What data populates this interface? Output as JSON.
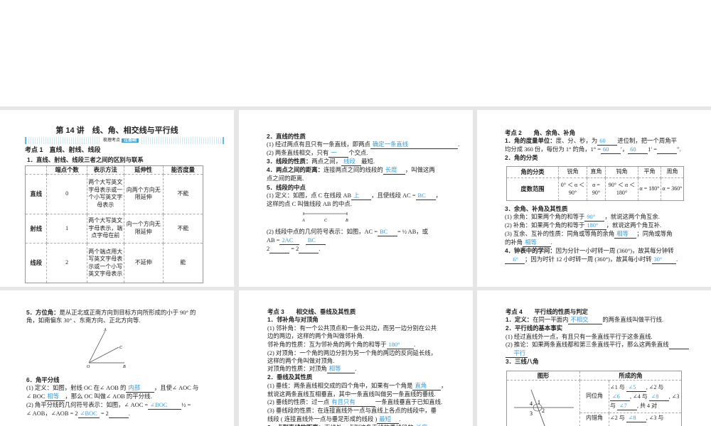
{
  "p1": {
    "title": "第 14 讲　线、角、相交线与平行线",
    "banner_left": "梳理考点",
    "banner_right": "过基础",
    "kd": "考点 1　直线、射线、线段",
    "l1": "1．直线、射线、线段三者之间的区别与联系",
    "table": {
      "headers": [
        "",
        "端点个数",
        "表示方法",
        "延伸性",
        "能否度量"
      ],
      "rows": [
        [
          "直线",
          "0",
          "两个大写英文字母表示或一个小写英文字母表示",
          "向两个方向无限延伸",
          "不能"
        ],
        [
          "射线",
          "1",
          "两个大写英文字母表示，端点字母在前",
          "向一个方向无限延伸",
          "不能"
        ],
        [
          "线段",
          "2",
          "两个端点用大写英文字母表示或一个小写英文字母表示",
          "不延伸",
          "能"
        ]
      ]
    }
  },
  "p2": {
    "a": [
      [
        {
          "s": "2．直线的性质"
        }
      ],
      [
        {
          "t": "(1) 经过两点有且只有一条直线，即两点"
        },
        {
          "b": "确定一条直线　　　　　　　　"
        },
        {
          "t": "."
        }
      ],
      [
        {
          "t": "(2) 两条直线相交，只有"
        },
        {
          "b": "一"
        },
        {
          "t": "个交点."
        }
      ],
      [
        {
          "s": "3．线段的性质："
        },
        {
          "t": "两点之间，"
        },
        {
          "b": "线段"
        },
        {
          "t": "最短."
        }
      ],
      [
        {
          "s": "4．两点之间的距离："
        },
        {
          "t": "连接两点之间的线段的"
        },
        {
          "b": "长度　"
        },
        {
          "t": "，叫做这两"
        }
      ],
      [
        {
          "t": "点之间的距离."
        }
      ]
    ],
    "b": [
      [
        {
          "s": "5．线段的中点"
        }
      ],
      [
        {
          "t": "(1) 定义：如图，点 C 在线段 AB"
        },
        {
          "b": "上"
        },
        {
          "t": "，且使线段 AC ="
        },
        {
          "b": "BC　"
        },
        {
          "t": "，"
        }
      ],
      [
        {
          "t": "这样的点 C 叫做线段 AB 的中点."
        }
      ]
    ],
    "pts": [
      "A",
      "C",
      "B"
    ],
    "c": [
      [
        {
          "t": "(2) 线段中点的几何符号表示：如图，AC ="
        },
        {
          "b": "BC　"
        },
        {
          "t": "= ½ AB，或"
        }
      ],
      [
        {
          "t": "AB ="
        },
        {
          "b": "2AC"
        },
        {
          "t": "　"
        },
        {
          "b": "BC"
        }
      ],
      [
        {
          "t": "2"
        },
        {
          "b": "　"
        },
        {
          "t": " = 2"
        },
        {
          "b": "　"
        },
        {
          "t": "."
        }
      ]
    ]
  },
  "p3": {
    "a": [
      [
        {
          "s": "考点 2　　角、余角、补角"
        }
      ],
      [
        {
          "s": "1．角的度量单位："
        },
        {
          "t": "度、分、秒，为"
        },
        {
          "b": "60"
        },
        {
          "t": "进位制，把一个周角平"
        }
      ],
      [
        {
          "t": "均分成 360 份，每份为 1° 的角，1° ="
        },
        {
          "b": "60"
        },
        {
          "t": "′，"
        },
        {
          "b": "60"
        },
        {
          "t": "1′ ="
        },
        {
          "b": "　"
        },
        {
          "t": "″."
        }
      ],
      [
        {
          "s": "2．角的分类"
        }
      ]
    ],
    "table": {
      "headers": [
        "角的分类",
        "锐角",
        "直角",
        "钝角",
        "平角",
        "周角"
      ],
      "row": [
        "度数范围",
        "0° ＜ α ＜ 90°",
        "α = 90°",
        "90° ＜ α ＜ 180°",
        "α = 180°",
        "α = 360°"
      ]
    },
    "b": [
      [
        {
          "s": "3．余角、补角及其性质"
        }
      ],
      [
        {
          "t": "(1) 余角：如果两个角的和等于"
        },
        {
          "b": "90°　"
        },
        {
          "t": "，就说这两个角互余."
        }
      ],
      [
        {
          "t": "(2) 补角：如果两个角的和等于"
        },
        {
          "b": "180°　"
        },
        {
          "t": "，就说这两个角互补."
        }
      ],
      [
        {
          "t": "(3) 互余、互补的性质：同角或等角的余角"
        },
        {
          "b": "相等　"
        },
        {
          "t": "；同角或等角"
        }
      ],
      [
        {
          "t": "的补角"
        },
        {
          "b": "相等　　"
        },
        {
          "t": "."
        }
      ],
      [
        {
          "s": "4．钟表中的学问："
        },
        {
          "t": "因为分针一小时转一周 (360°)，故其每分钟转"
        }
      ],
      [
        {
          "b": "　6°"
        },
        {
          "t": "；因为时针 12 小时转一周 (360°)，故其每小时转"
        },
        {
          "b": "30°　　"
        },
        {
          "t": "."
        }
      ]
    ]
  },
  "p4": {
    "a": [
      [
        {
          "s": "5．方位角："
        },
        {
          "t": "是从正北或正南方向到目标方向所形成的小于 90° 的"
        }
      ],
      [
        {
          "t": "角，如南偏东 30° 、东南方向、正北方向等."
        }
      ]
    ],
    "pts": [
      "A",
      "C",
      "O",
      "B"
    ],
    "b": [
      [
        {
          "s": "6．角平分线"
        }
      ],
      [
        {
          "t": "(1) 定义：如图，射线 OC 在∠ AOB 的"
        },
        {
          "b": "内部　　"
        },
        {
          "t": "，且使∠ AOC 与"
        }
      ],
      [
        {
          "t": "∠ BOC"
        },
        {
          "b": "相等"
        },
        {
          "t": "，那么 OC 叫做∠ AOB 的平分线."
        }
      ],
      [
        {
          "t": "(2) 角平分线的几何符号表示：如图，∠ AOC ="
        },
        {
          "b": "∠BOC　　"
        },
        {
          "t": "½ ="
        }
      ],
      [
        {
          "t": "∠ AOB，∠AOB = 2"
        },
        {
          "b": "∠BOC"
        },
        {
          "t": " = 2"
        },
        {
          "b": "　　"
        },
        {
          "t": "."
        }
      ]
    ]
  },
  "p5": {
    "a": [
      [
        {
          "s": "考点 3　　相交线、垂线及其性质"
        }
      ],
      [
        {
          "s": "1．邻补角与对顶角"
        }
      ],
      [
        {
          "t": "(1) 邻补角：有一个公共顶点和一条公共边，而另一边分别在公共"
        }
      ],
      [
        {
          "t": "边的两边，这样的两个角叫做邻补角."
        }
      ],
      [
        {
          "t": "邻补角的性质：互为邻补角的两个角的和等于"
        },
        {
          "b": "180°　　"
        },
        {
          "t": "."
        }
      ],
      [
        {
          "t": "(2) 对顶角：一个角的两边分别为另一个角的两边的反向延长线，"
        }
      ],
      [
        {
          "t": "这样的两个角叫做对顶角."
        }
      ],
      [
        {
          "t": "对顶角的性质：对顶角"
        },
        {
          "b": "相等　　"
        },
        {
          "t": "."
        }
      ],
      [
        {
          "s": "2．垂线及其性质"
        }
      ],
      [
        {
          "t": "(1) 垂线：两条直线相交成的四个角中，如果有一个角是"
        },
        {
          "b": "直角　　"
        },
        {
          "t": "，"
        }
      ],
      [
        {
          "t": "就说这两条直线互相垂直，其中一条直线叫做另一条直线的垂线."
        }
      ],
      [
        {
          "t": "(2) 垂线的性质：过一点"
        },
        {
          "b": "有且只有　　　"
        },
        {
          "t": "一条直线垂直于已知直线."
        }
      ],
      [
        {
          "t": "(3) 垂线段的性质：在连接直线外一点与直线上各点的线段中，垂"
        }
      ],
      [
        {
          "t": "线段 ( 连接直线外一点与垂足形成的线段 )"
        },
        {
          "b": "最短　"
        },
        {
          "t": "."
        }
      ],
      [
        {
          "s": "3．点到直线的距离："
        },
        {
          "t": "直线外一点到这条直线的垂线段的"
        },
        {
          "b": "长度　　"
        },
        {
          "t": "，"
        }
      ]
    ]
  },
  "p6": {
    "a": [
      [
        {
          "s": "考点 4　　平行线的性质与判定"
        }
      ],
      [
        {
          "s": "1．定义："
        },
        {
          "t": "在同一平面内"
        },
        {
          "b": "不相交　　"
        },
        {
          "t": "的两条直线叫做平行线."
        }
      ],
      [
        {
          "s": "2．平行线的基本事实"
        }
      ],
      [
        {
          "t": "(1) 经过直线外一点，有且只有一条直线平行于这条直线."
        }
      ],
      [
        {
          "t": "(2) 推论：如果两条直线都和第三条直线平行，那么这两条直线"
        },
        {
          "b": "　　"
        }
      ],
      [
        {
          "b": "　平行"
        }
      ],
      [
        {
          "s": "3．三线八角"
        }
      ]
    ],
    "table": {
      "headers": [
        "图形",
        "所成的角"
      ],
      "r1_name": "同位角",
      "r1": [
        "∠1 与",
        "∠5",
        ", ∠2 与",
        "∠6",
        ", ∠4 与",
        "∠8",
        ",",
        "∠3 与",
        "∠7",
        ", 共 4 对"
      ],
      "r2_name": "内错角",
      "r2": [
        "∠2 与",
        "∠8",
        ", ∠3 与"
      ],
      "fig": [
        "4",
        "1",
        "3",
        "2"
      ]
    }
  }
}
